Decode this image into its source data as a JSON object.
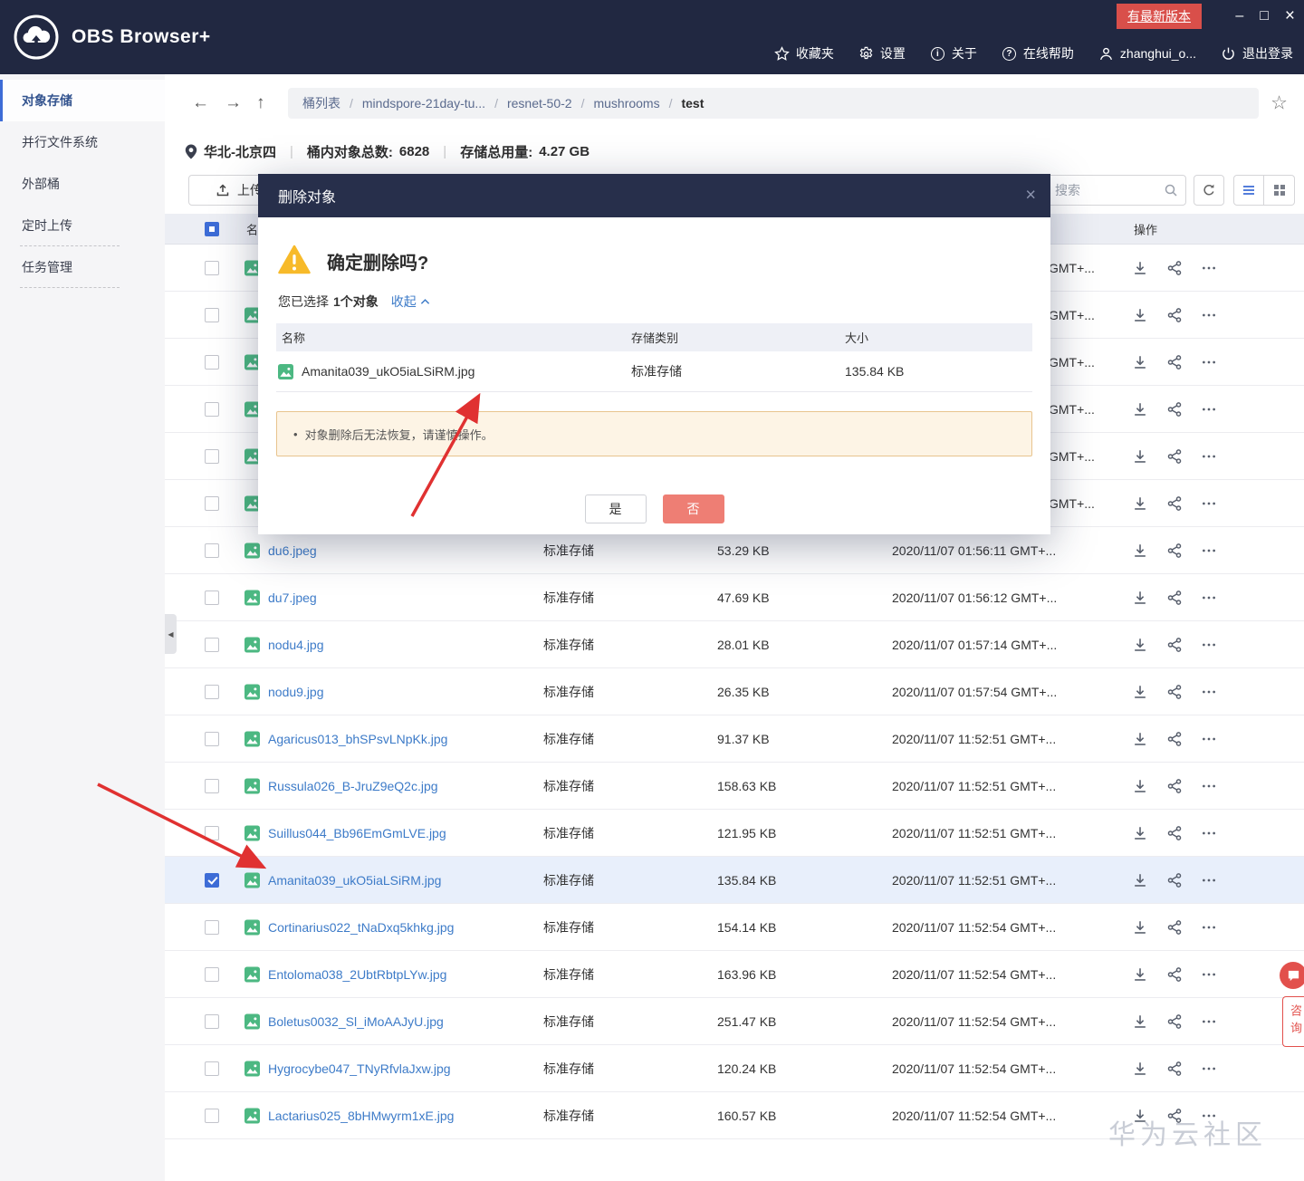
{
  "chrome": {
    "app_title": "OBS Browser+",
    "update_badge": "有最新版本",
    "nav": [
      {
        "id": "favorites",
        "label": "收藏夹"
      },
      {
        "id": "settings",
        "label": "设置"
      },
      {
        "id": "about",
        "label": "关于"
      },
      {
        "id": "help",
        "label": "在线帮助"
      },
      {
        "id": "user",
        "label": "zhanghui_o..."
      },
      {
        "id": "logout",
        "label": "退出登录"
      }
    ]
  },
  "sidebar": [
    {
      "id": "object-storage",
      "label": "对象存储",
      "active": true,
      "dashed": false
    },
    {
      "id": "parallel-file-system",
      "label": "并行文件系统",
      "active": false,
      "dashed": false
    },
    {
      "id": "external-bucket",
      "label": "外部桶",
      "active": false,
      "dashed": false
    },
    {
      "id": "scheduled-upload",
      "label": "定时上传",
      "active": false,
      "dashed": true
    },
    {
      "id": "task-management",
      "label": "任务管理",
      "active": false,
      "dashed": true
    }
  ],
  "breadcrumb": [
    "桶列表",
    "mindspore-21day-tu...",
    "resnet-50-2",
    "mushrooms",
    "test"
  ],
  "infobar": {
    "region": "华北-北京四",
    "count_label": "桶内对象总数:",
    "count_value": "6828",
    "usage_label": "存储总用量:",
    "usage_value": "4.27 GB"
  },
  "toolbar": {
    "upload_label": "上传",
    "search_placeholder": "搜索"
  },
  "table": {
    "name_header": "名称",
    "action_header": "操作",
    "hidden_rows": [
      {
        "date_fragment": "GMT+..."
      },
      {
        "date_fragment": "GMT+..."
      },
      {
        "date_fragment": "GMT+..."
      },
      {
        "date_fragment": "GMT+..."
      },
      {
        "date_fragment": "GMT+..."
      },
      {
        "date_fragment": "GMT+..."
      }
    ],
    "rows": [
      {
        "name": "du6.jpeg",
        "storage_class": "标准存储",
        "size": "53.29 KB",
        "date": "2020/11/07 01:56:11 GMT+...",
        "selected": false
      },
      {
        "name": "du7.jpeg",
        "storage_class": "标准存储",
        "size": "47.69 KB",
        "date": "2020/11/07 01:56:12 GMT+...",
        "selected": false
      },
      {
        "name": "nodu4.jpg",
        "storage_class": "标准存储",
        "size": "28.01 KB",
        "date": "2020/11/07 01:57:14 GMT+...",
        "selected": false
      },
      {
        "name": "nodu9.jpg",
        "storage_class": "标准存储",
        "size": "26.35 KB",
        "date": "2020/11/07 01:57:54 GMT+...",
        "selected": false
      },
      {
        "name": "Agaricus013_bhSPsvLNpKk.jpg",
        "storage_class": "标准存储",
        "size": "91.37 KB",
        "date": "2020/11/07 11:52:51 GMT+...",
        "selected": false
      },
      {
        "name": "Russula026_B-JruZ9eQ2c.jpg",
        "storage_class": "标准存储",
        "size": "158.63 KB",
        "date": "2020/11/07 11:52:51 GMT+...",
        "selected": false
      },
      {
        "name": "Suillus044_Bb96EmGmLVE.jpg",
        "storage_class": "标准存储",
        "size": "121.95 KB",
        "date": "2020/11/07 11:52:51 GMT+...",
        "selected": false
      },
      {
        "name": "Amanita039_ukO5iaLSiRM.jpg",
        "storage_class": "标准存储",
        "size": "135.84 KB",
        "date": "2020/11/07 11:52:51 GMT+...",
        "selected": true
      },
      {
        "name": "Cortinarius022_tNaDxq5khkg.jpg",
        "storage_class": "标准存储",
        "size": "154.14 KB",
        "date": "2020/11/07 11:52:54 GMT+...",
        "selected": false
      },
      {
        "name": "Entoloma038_2UbtRbtpLYw.jpg",
        "storage_class": "标准存储",
        "size": "163.96 KB",
        "date": "2020/11/07 11:52:54 GMT+...",
        "selected": false
      },
      {
        "name": "Boletus0032_Sl_iMoAAJyU.jpg",
        "storage_class": "标准存储",
        "size": "251.47 KB",
        "date": "2020/11/07 11:52:54 GMT+...",
        "selected": false
      },
      {
        "name": "Hygrocybe047_TNyRfvlaJxw.jpg",
        "storage_class": "标准存储",
        "size": "120.24 KB",
        "date": "2020/11/07 11:52:54 GMT+...",
        "selected": false
      },
      {
        "name": "Lactarius025_8bHMwyrm1xE.jpg",
        "storage_class": "标准存储",
        "size": "160.57 KB",
        "date": "2020/11/07 11:52:54 GMT+...",
        "selected": false
      }
    ]
  },
  "dialog": {
    "title": "删除对象",
    "question": "确定删除吗?",
    "selected_prefix": "您已选择",
    "selected_count": "1个对象",
    "collapse_label": "收起",
    "columns": {
      "name": "名称",
      "storage_class": "存储类别",
      "size": "大小"
    },
    "file": {
      "name": "Amanita039_ukO5iaLSiRM.jpg",
      "storage_class": "标准存储",
      "size": "135.84 KB"
    },
    "warning": "对象删除后无法恢复，请谨慎操作。",
    "yes_label": "是",
    "no_label": "否"
  },
  "chat_widget": {
    "label": "咨询"
  },
  "watermark": "华为云社区",
  "colors": {
    "header_bg": "#212841",
    "accent_blue": "#3d6cd6",
    "link_blue": "#3d7bc8",
    "badge_red": "#d94f4a",
    "danger_button": "#ee7e74",
    "selected_row": "#e8effb",
    "notice_bg": "#fdf4e5",
    "notice_border": "#e8c48e",
    "arrow_red": "#e03131"
  }
}
